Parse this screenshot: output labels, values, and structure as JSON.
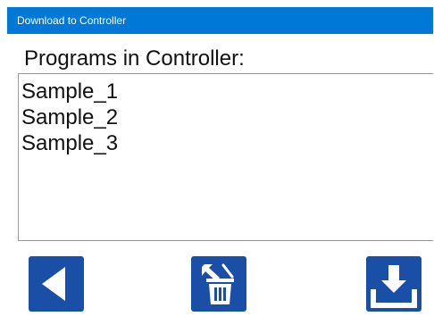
{
  "window": {
    "title": "Download to Controller"
  },
  "programs": {
    "label": "Programs in Controller:",
    "items": [
      "Sample_1",
      "Sample_2",
      "Sample_3"
    ]
  },
  "toolbar": {
    "back_icon": "back-triangle-icon",
    "delete_icon": "trash-delete-icon",
    "download_icon": "download-arrow-icon"
  },
  "colors": {
    "titlebar": "#0078d7",
    "button": "#1a4fa8"
  }
}
